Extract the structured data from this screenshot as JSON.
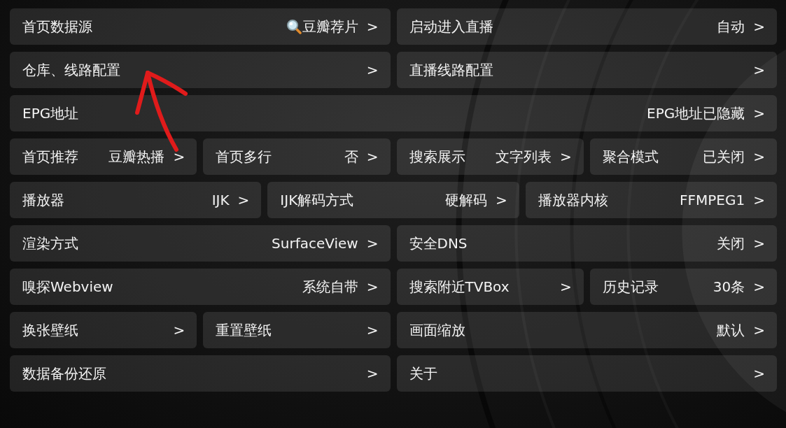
{
  "rows": [
    {
      "items": [
        {
          "label": "首页数据源",
          "value": "豆瓣荐片",
          "value_icon": true,
          "chevron": ">"
        },
        {
          "label": "启动进入直播",
          "value": "自动",
          "chevron": ">"
        }
      ]
    },
    {
      "items": [
        {
          "label": "仓库、线路配置",
          "chevron": ">"
        },
        {
          "label": "直播线路配置",
          "chevron": ">"
        }
      ]
    },
    {
      "items": [
        {
          "label": "EPG地址",
          "value": "EPG地址已隐藏",
          "chevron": ">"
        }
      ]
    },
    {
      "items": [
        {
          "label": "首页推荐",
          "value": "豆瓣热播",
          "chevron": ">"
        },
        {
          "label": "首页多行",
          "value": "否",
          "chevron": ">"
        },
        {
          "label": "搜索展示",
          "value": "文字列表",
          "chevron": ">"
        },
        {
          "label": "聚合模式",
          "value": "已关闭",
          "chevron": ">"
        }
      ]
    },
    {
      "items": [
        {
          "label": "播放器",
          "value": "IJK",
          "chevron": ">"
        },
        {
          "label": "IJK解码方式",
          "value": "硬解码",
          "chevron": ">"
        },
        {
          "label": "播放器内核",
          "value": "FFMPEG1",
          "chevron": ">"
        }
      ]
    },
    {
      "items": [
        {
          "label": "渲染方式",
          "value": "SurfaceView",
          "chevron": ">"
        },
        {
          "label": "安全DNS",
          "value": "关闭",
          "chevron": ">"
        }
      ]
    },
    {
      "items": [
        {
          "label": "嗅探Webview",
          "value": "系统自带",
          "chevron": ">"
        },
        {
          "label": "搜索附近TVBox",
          "chevron": ">"
        },
        {
          "label": "历史记录",
          "value": "30条",
          "chevron": ">"
        }
      ]
    },
    {
      "items": [
        {
          "label": "换张壁纸",
          "chevron": ">"
        },
        {
          "label": "重置壁纸",
          "chevron": ">"
        },
        {
          "label": "画面缩放",
          "value": "默认",
          "chevron": ">"
        }
      ]
    },
    {
      "items": [
        {
          "label": "数据备份还原",
          "chevron": ">"
        },
        {
          "label": "关于",
          "chevron": ">"
        }
      ]
    }
  ]
}
